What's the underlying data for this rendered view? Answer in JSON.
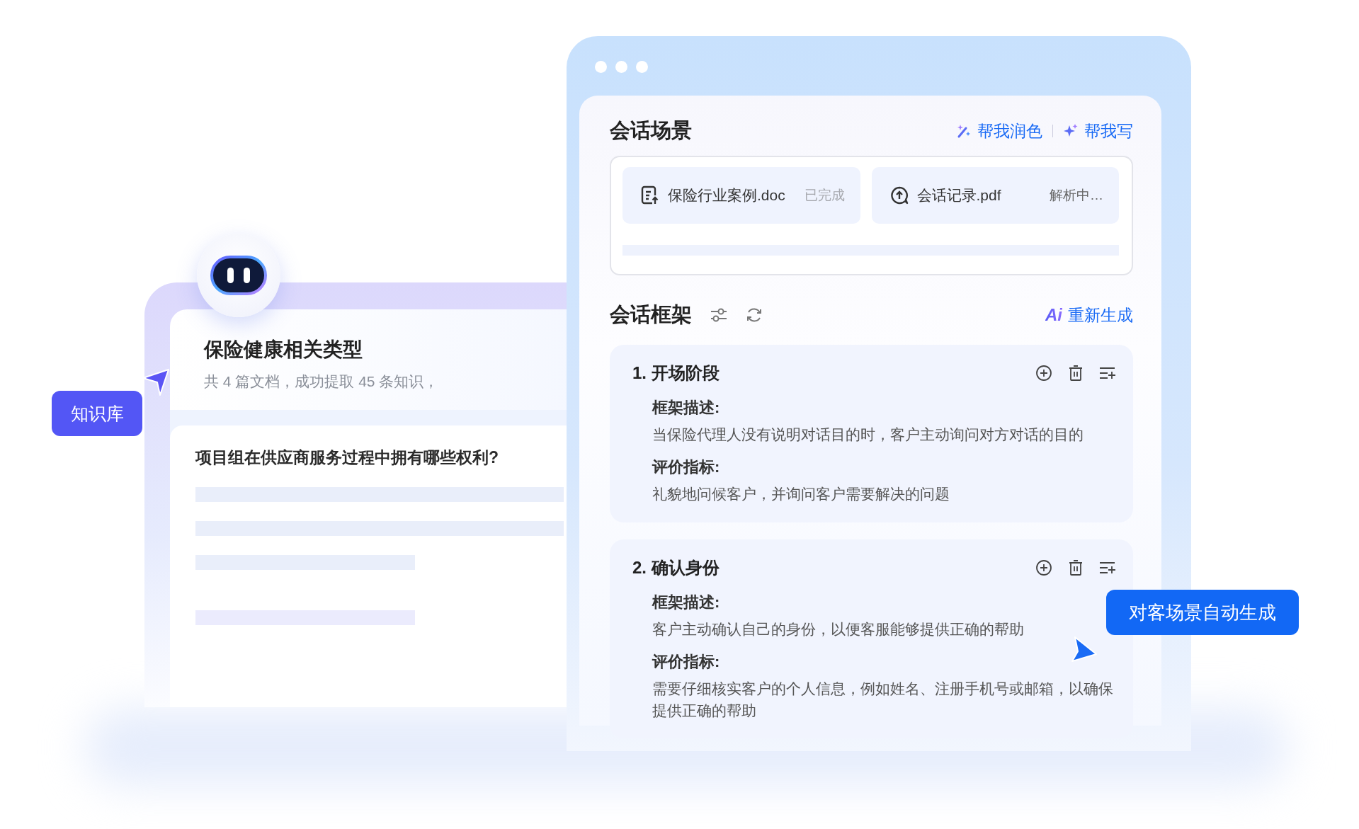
{
  "knowledge_badge": "知识库",
  "knowledge_card": {
    "title": "保险健康相关类型",
    "summary": "共 4 篇文档，成功提取 45 条知识，",
    "question": "项目组在供应商服务过程中拥有哪些权利?"
  },
  "window": {
    "scene": {
      "title": "会话场景",
      "actions": [
        {
          "label": "帮我润色",
          "kind": "polish"
        },
        {
          "label": "帮我写",
          "kind": "write"
        }
      ],
      "files": [
        {
          "name": "保险行业案例.doc",
          "status": "已完成",
          "kind": "document",
          "done": true
        },
        {
          "name": "会话记录.pdf",
          "status": "解析中…",
          "kind": "upload",
          "done": false
        }
      ]
    },
    "framework": {
      "title": "会话框架",
      "ai_mark": "Ai",
      "regenerate": "重新生成",
      "stages": [
        {
          "title": "1. 开场阶段",
          "desc_label": "框架描述:",
          "desc": "当保险代理人没有说明对话目的时，客户主动询问对方对话的目的",
          "metric_label": "评价指标:",
          "metric": "礼貌地问候客户，并询问客户需要解决的问题"
        },
        {
          "title": "2. 确认身份",
          "desc_label": "框架描述:",
          "desc": "客户主动确认自己的身份，以便客服能够提供正确的帮助",
          "metric_label": "评价指标:",
          "metric": "需要仔细核实客户的个人信息，例如姓名、注册手机号或邮箱，以确保提供正确的帮助"
        }
      ]
    }
  },
  "callout": "对客场景自动生成"
}
